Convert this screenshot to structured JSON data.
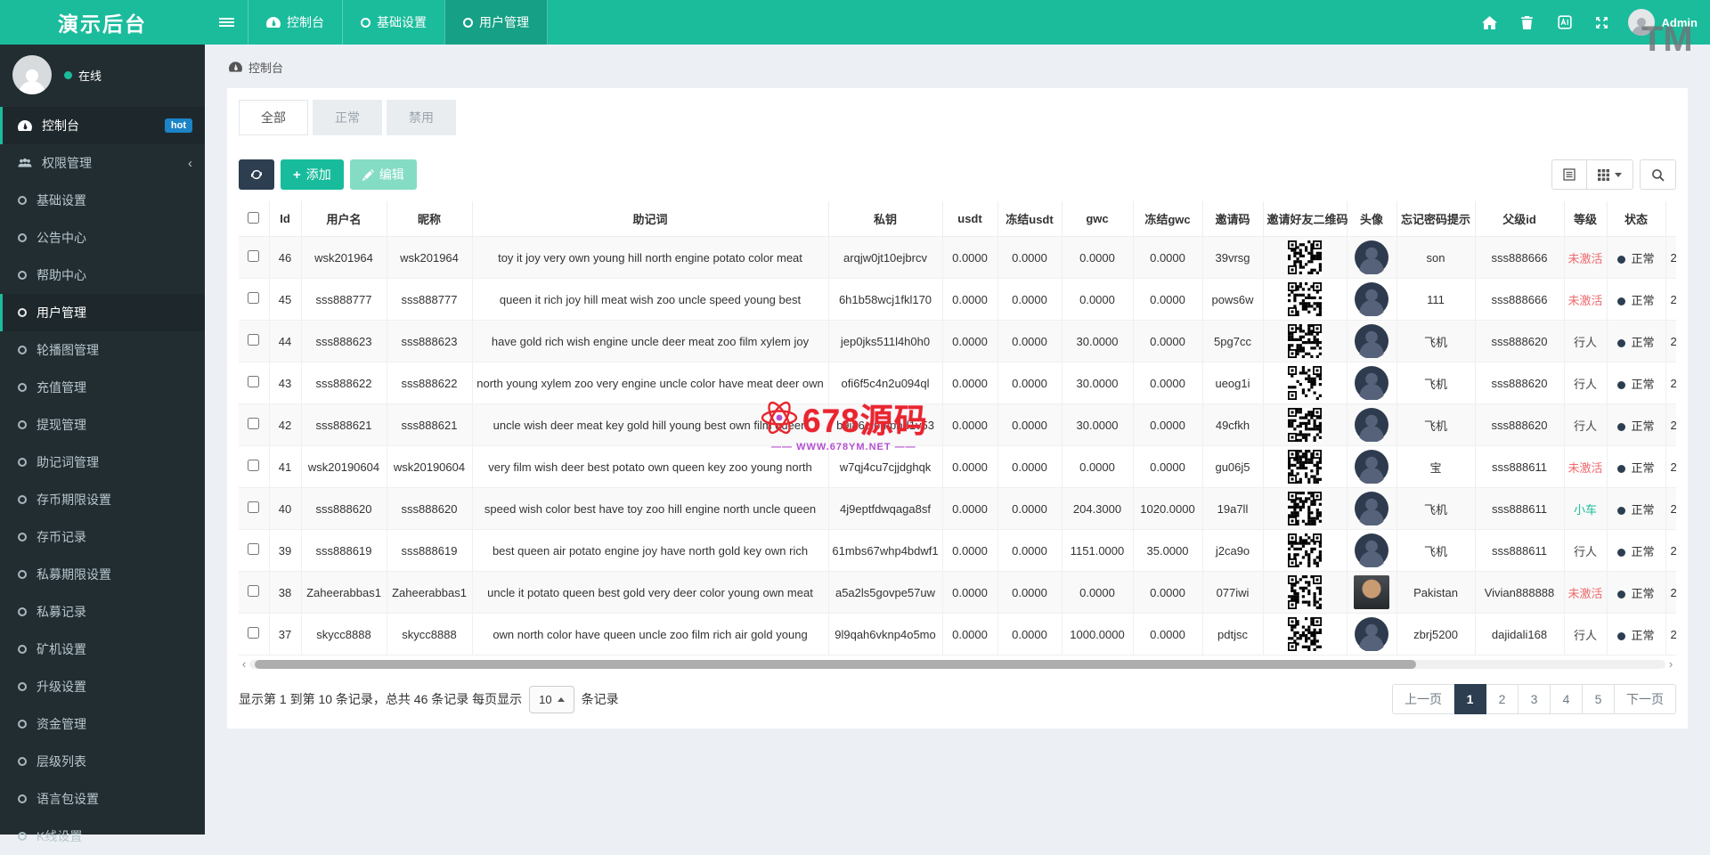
{
  "app": {
    "title": "演示后台"
  },
  "watermarks": {
    "tm": "TM",
    "site_name": "678源码",
    "site_url": "WWW.678YM.NET"
  },
  "topnav": {
    "items": [
      {
        "label": "控制台",
        "icon": "dashboard",
        "active": false
      },
      {
        "label": "基础设置",
        "icon": "circle",
        "active": false
      },
      {
        "label": "用户管理",
        "icon": "circle",
        "active": true
      }
    ],
    "right_icons": [
      "home",
      "trash",
      "language",
      "fullscreen"
    ],
    "user_name": "Admin"
  },
  "sidebar": {
    "online_status": "在线",
    "items": [
      {
        "label": "控制台",
        "icon": "dashboard",
        "badge": "hot",
        "active": true
      },
      {
        "label": "权限管理",
        "icon": "users",
        "chevron": "‹",
        "active": false
      },
      {
        "label": "基础设置",
        "icon": "circle",
        "active": false
      },
      {
        "label": "公告中心",
        "icon": "circle",
        "active": false
      },
      {
        "label": "帮助中心",
        "icon": "circle",
        "active": false
      },
      {
        "label": "用户管理",
        "icon": "circle",
        "active": true
      },
      {
        "label": "轮播图管理",
        "icon": "circle",
        "active": false
      },
      {
        "label": "充值管理",
        "icon": "circle",
        "active": false
      },
      {
        "label": "提现管理",
        "icon": "circle",
        "active": false
      },
      {
        "label": "助记词管理",
        "icon": "circle",
        "active": false
      },
      {
        "label": "存币期限设置",
        "icon": "circle",
        "active": false
      },
      {
        "label": "存币记录",
        "icon": "circle",
        "active": false
      },
      {
        "label": "私募期限设置",
        "icon": "circle",
        "active": false
      },
      {
        "label": "私募记录",
        "icon": "circle",
        "active": false
      },
      {
        "label": "矿机设置",
        "icon": "circle",
        "active": false
      },
      {
        "label": "升级设置",
        "icon": "circle",
        "active": false
      },
      {
        "label": "资金管理",
        "icon": "circle",
        "active": false
      },
      {
        "label": "层级列表",
        "icon": "circle",
        "active": false
      },
      {
        "label": "语言包设置",
        "icon": "circle",
        "active": false
      },
      {
        "label": "K线设置",
        "icon": "circle",
        "active": false
      }
    ]
  },
  "breadcrumb": {
    "label": "控制台"
  },
  "tabs": [
    {
      "label": "全部",
      "active": true
    },
    {
      "label": "正常",
      "active": false
    },
    {
      "label": "禁用",
      "active": false
    }
  ],
  "toolbar": {
    "add_label": "添加",
    "edit_label": "编辑"
  },
  "table": {
    "headers": {
      "id": "Id",
      "username": "用户名",
      "nickname": "昵称",
      "mnemonic": "助记词",
      "private_key": "私钥",
      "usdt": "usdt",
      "frozen_usdt": "冻结usdt",
      "gwc": "gwc",
      "frozen_gwc": "冻结gwc",
      "invite_code": "邀请码",
      "qr": "邀请好友二维码",
      "avatar": "头像",
      "password_hint": "忘记密码提示",
      "parent_id": "父级id",
      "level": "等级",
      "status": "状态",
      "date": ""
    },
    "level_colors": {
      "未激活": "#ed6a6d",
      "行人": "#444444",
      "小车": "#1abc9c"
    },
    "rows": [
      {
        "id": "46",
        "username": "wsk201964",
        "nickname": "wsk201964",
        "mnemonic": "toy it joy very own young hill north engine potato color meat",
        "private_key": "arqjw0jt10ejbrcv",
        "usdt": "0.0000",
        "frozen_usdt": "0.0000",
        "gwc": "0.0000",
        "frozen_gwc": "0.0000",
        "invite_code": "39vrsg",
        "avatar": "person",
        "password_hint": "son",
        "parent_id": "sss888666",
        "level": "未激活",
        "status": "正常",
        "date_sliver": "2"
      },
      {
        "id": "45",
        "username": "sss888777",
        "nickname": "sss888777",
        "mnemonic": "queen it rich joy hill meat wish zoo uncle speed young best",
        "private_key": "6h1b58wcj1fkl170",
        "usdt": "0.0000",
        "frozen_usdt": "0.0000",
        "gwc": "0.0000",
        "frozen_gwc": "0.0000",
        "invite_code": "pows6w",
        "avatar": "person",
        "password_hint": "111",
        "parent_id": "sss888666",
        "level": "未激活",
        "status": "正常",
        "date_sliver": "2"
      },
      {
        "id": "44",
        "username": "sss888623",
        "nickname": "sss888623",
        "mnemonic": "have gold rich wish engine uncle deer meat zoo film xylem joy",
        "private_key": "jep0jks511l4h0h0",
        "usdt": "0.0000",
        "frozen_usdt": "0.0000",
        "gwc": "30.0000",
        "frozen_gwc": "0.0000",
        "invite_code": "5pg7cc",
        "avatar": "person",
        "password_hint": "飞机",
        "parent_id": "sss888620",
        "level": "行人",
        "status": "正常",
        "date_sliver": "2"
      },
      {
        "id": "43",
        "username": "sss888622",
        "nickname": "sss888622",
        "mnemonic": "north young xylem zoo very engine uncle color have meat deer own",
        "private_key": "ofi6f5c4n2u094ql",
        "usdt": "0.0000",
        "frozen_usdt": "0.0000",
        "gwc": "30.0000",
        "frozen_gwc": "0.0000",
        "invite_code": "ueog1i",
        "avatar": "person",
        "password_hint": "飞机",
        "parent_id": "sss888620",
        "level": "行人",
        "status": "正常",
        "date_sliver": "2"
      },
      {
        "id": "42",
        "username": "sss888621",
        "nickname": "sss888621",
        "mnemonic": "uncle wish deer meat key gold hill young best own film queen",
        "private_key": "b9i86olpmpbd1v53",
        "usdt": "0.0000",
        "frozen_usdt": "0.0000",
        "gwc": "30.0000",
        "frozen_gwc": "0.0000",
        "invite_code": "49cfkh",
        "avatar": "person",
        "password_hint": "飞机",
        "parent_id": "sss888620",
        "level": "行人",
        "status": "正常",
        "date_sliver": "2"
      },
      {
        "id": "41",
        "username": "wsk20190604",
        "nickname": "wsk20190604",
        "mnemonic": "very film wish deer best potato own queen key zoo young north",
        "private_key": "w7qj4cu7cjjdghqk",
        "usdt": "0.0000",
        "frozen_usdt": "0.0000",
        "gwc": "0.0000",
        "frozen_gwc": "0.0000",
        "invite_code": "gu06j5",
        "avatar": "person",
        "password_hint": "宝",
        "parent_id": "sss888611",
        "level": "未激活",
        "status": "正常",
        "date_sliver": "2"
      },
      {
        "id": "40",
        "username": "sss888620",
        "nickname": "sss888620",
        "mnemonic": "speed wish color best have toy zoo hill engine north uncle queen",
        "private_key": "4j9eptfdwqaga8sf",
        "usdt": "0.0000",
        "frozen_usdt": "0.0000",
        "gwc": "204.3000",
        "frozen_gwc": "1020.0000",
        "invite_code": "19a7ll",
        "avatar": "person",
        "password_hint": "飞机",
        "parent_id": "sss888611",
        "level": "小车",
        "status": "正常",
        "date_sliver": "2"
      },
      {
        "id": "39",
        "username": "sss888619",
        "nickname": "sss888619",
        "mnemonic": "best queen air potato engine joy have north gold key own rich",
        "private_key": "61mbs67whp4bdwf1",
        "usdt": "0.0000",
        "frozen_usdt": "0.0000",
        "gwc": "1151.0000",
        "frozen_gwc": "35.0000",
        "invite_code": "j2ca9o",
        "avatar": "person",
        "password_hint": "飞机",
        "parent_id": "sss888611",
        "level": "行人",
        "status": "正常",
        "date_sliver": "2"
      },
      {
        "id": "38",
        "username": "Zaheerabbas1",
        "nickname": "Zaheerabbas1",
        "mnemonic": "uncle it potato queen best gold very deer color young own meat",
        "private_key": "a5a2ls5govpe57uw",
        "usdt": "0.0000",
        "frozen_usdt": "0.0000",
        "gwc": "0.0000",
        "frozen_gwc": "0.0000",
        "invite_code": "077iwi",
        "avatar": "photo",
        "password_hint": "Pakistan",
        "parent_id": "Vivian888888",
        "level": "未激活",
        "status": "正常",
        "date_sliver": "2"
      },
      {
        "id": "37",
        "username": "skycc8888",
        "nickname": "skycc8888",
        "mnemonic": "own north color have queen uncle zoo film rich air gold young",
        "private_key": "9l9qah6vknp4o5mo",
        "usdt": "0.0000",
        "frozen_usdt": "0.0000",
        "gwc": "1000.0000",
        "frozen_gwc": "0.0000",
        "invite_code": "pdtjsc",
        "avatar": "person",
        "password_hint": "zbrj5200",
        "parent_id": "dajidali168",
        "level": "行人",
        "status": "正常",
        "date_sliver": "2"
      }
    ]
  },
  "footer": {
    "summary_prefix": "显示第 1 到第 10 条记录，总共 46 条记录 每页显示",
    "page_size": "10",
    "summary_suffix": "条记录",
    "pagination": [
      {
        "label": "上一页",
        "active": false
      },
      {
        "label": "1",
        "active": true
      },
      {
        "label": "2",
        "active": false
      },
      {
        "label": "3",
        "active": false
      },
      {
        "label": "4",
        "active": false
      },
      {
        "label": "5",
        "active": false
      },
      {
        "label": "下一页",
        "active": false
      }
    ]
  },
  "colors": {
    "accent": "#1abc9c",
    "dark": "#2c3e50",
    "sidebar": "#222d32",
    "badge_blue": "#1c84c6",
    "danger": "#ed6a6d"
  }
}
